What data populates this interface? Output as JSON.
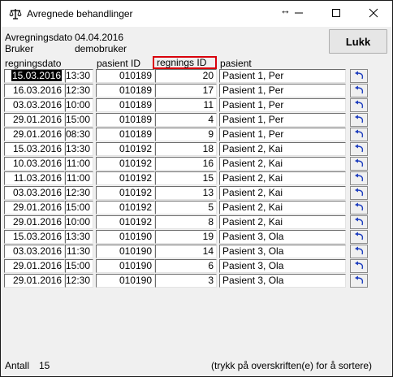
{
  "window": {
    "title": "Avregnede behandlinger",
    "resize_glyph": "↔"
  },
  "header": {
    "date_label": "Avregningsdato",
    "date_value": "04.04.2016",
    "user_label": "Bruker",
    "user_value": "demobruker",
    "close_label": "Lukk"
  },
  "columns": {
    "date": "regningsdato",
    "patient_id": "pasient ID",
    "invoice_id": "regnings ID",
    "patient": "pasient"
  },
  "rows": [
    {
      "date": "15.03.2016",
      "time": "13:30",
      "patient_id": "010189",
      "invoice_id": "20",
      "patient": "Pasient 1, Per"
    },
    {
      "date": "16.03.2016",
      "time": "12:30",
      "patient_id": "010189",
      "invoice_id": "17",
      "patient": "Pasient 1, Per"
    },
    {
      "date": "03.03.2016",
      "time": "10:00",
      "patient_id": "010189",
      "invoice_id": "11",
      "patient": "Pasient 1, Per"
    },
    {
      "date": "29.01.2016",
      "time": "15:00",
      "patient_id": "010189",
      "invoice_id": "4",
      "patient": "Pasient 1, Per"
    },
    {
      "date": "29.01.2016",
      "time": "08:30",
      "patient_id": "010189",
      "invoice_id": "9",
      "patient": "Pasient 1, Per"
    },
    {
      "date": "15.03.2016",
      "time": "13:30",
      "patient_id": "010192",
      "invoice_id": "18",
      "patient": "Pasient 2, Kai"
    },
    {
      "date": "10.03.2016",
      "time": "11:00",
      "patient_id": "010192",
      "invoice_id": "16",
      "patient": "Pasient 2, Kai"
    },
    {
      "date": "11.03.2016",
      "time": "11:00",
      "patient_id": "010192",
      "invoice_id": "15",
      "patient": "Pasient 2, Kai"
    },
    {
      "date": "03.03.2016",
      "time": "12:30",
      "patient_id": "010192",
      "invoice_id": "13",
      "patient": "Pasient 2, Kai"
    },
    {
      "date": "29.01.2016",
      "time": "15:00",
      "patient_id": "010192",
      "invoice_id": "5",
      "patient": "Pasient 2, Kai"
    },
    {
      "date": "29.01.2016",
      "time": "10:00",
      "patient_id": "010192",
      "invoice_id": "8",
      "patient": "Pasient 2, Kai"
    },
    {
      "date": "15.03.2016",
      "time": "13:30",
      "patient_id": "010190",
      "invoice_id": "19",
      "patient": "Pasient 3, Ola"
    },
    {
      "date": "03.03.2016",
      "time": "11:30",
      "patient_id": "010190",
      "invoice_id": "14",
      "patient": "Pasient 3, Ola"
    },
    {
      "date": "29.01.2016",
      "time": "15:00",
      "patient_id": "010190",
      "invoice_id": "6",
      "patient": "Pasient 3, Ola"
    },
    {
      "date": "29.01.2016",
      "time": "12:30",
      "patient_id": "010190",
      "invoice_id": "3",
      "patient": "Pasient 3, Ola"
    }
  ],
  "footer": {
    "count_label": "Antall",
    "count_value": "15",
    "sort_hint": "(trykk på overskriften(e) for å sortere)"
  },
  "colors": {
    "highlight_border": "#d9000c",
    "undo_icon": "#1f3fbf"
  }
}
